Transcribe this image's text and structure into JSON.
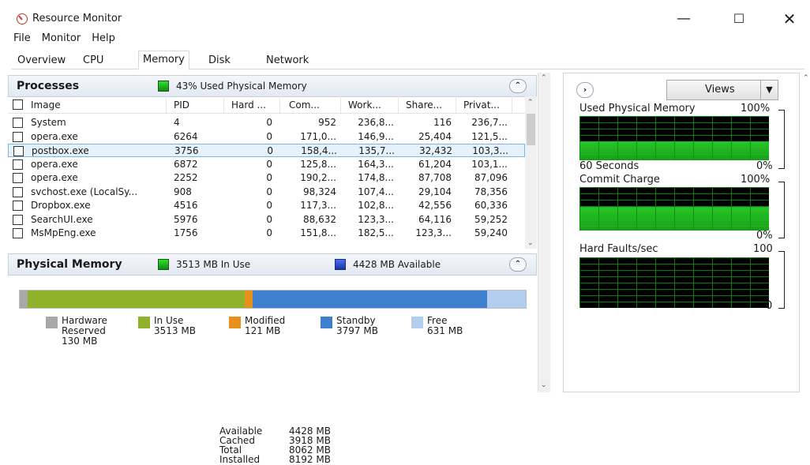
{
  "window": {
    "title": "Resource Monitor",
    "minimize": "—",
    "maximize": "☐",
    "close": "✕"
  },
  "menu": [
    "File",
    "Monitor",
    "Help"
  ],
  "tabs": [
    "Overview",
    "CPU",
    "Memory",
    "Disk",
    "Network"
  ],
  "active_tab": "Memory",
  "processes": {
    "title": "Processes",
    "summary": "43% Used Physical Memory",
    "columns": [
      "Image",
      "PID",
      "Hard ...",
      "Com...",
      "Work...",
      "Share...",
      "Privat..."
    ],
    "rows": [
      [
        "System",
        "4",
        "0",
        "952",
        "236,8...",
        "116",
        "236,7..."
      ],
      [
        "opera.exe",
        "6264",
        "0",
        "171,0...",
        "146,9...",
        "25,404",
        "121,5..."
      ],
      [
        "postbox.exe",
        "3756",
        "0",
        "158,4...",
        "135,7...",
        "32,432",
        "103,3..."
      ],
      [
        "opera.exe",
        "6872",
        "0",
        "125,8...",
        "164,3...",
        "61,204",
        "103,1..."
      ],
      [
        "opera.exe",
        "2252",
        "0",
        "190,2...",
        "174,8...",
        "87,708",
        "87,096"
      ],
      [
        "svchost.exe (LocalSy...",
        "908",
        "0",
        "98,324",
        "107,4...",
        "29,104",
        "78,356"
      ],
      [
        "Dropbox.exe",
        "4516",
        "0",
        "117,3...",
        "102,8...",
        "42,556",
        "60,336"
      ],
      [
        "SearchUI.exe",
        "5976",
        "0",
        "88,632",
        "123,3...",
        "64,116",
        "59,252"
      ],
      [
        "MsMpEng.exe",
        "1756",
        "0",
        "151,8...",
        "182,5...",
        "123,3...",
        "59,240"
      ]
    ],
    "selected_row": 2
  },
  "physical_memory": {
    "title": "Physical Memory",
    "in_use_label": "3513 MB In Use",
    "available_label": "4428 MB Available",
    "bar": [
      {
        "name": "Hardware Reserved",
        "mb": 130,
        "color": "#a8a8a8"
      },
      {
        "name": "In Use",
        "mb": 3513,
        "color": "#8fb22a"
      },
      {
        "name": "Modified",
        "mb": 121,
        "color": "#e8901c"
      },
      {
        "name": "Standby",
        "mb": 3797,
        "color": "#3f7fd0"
      },
      {
        "name": "Free",
        "mb": 631,
        "color": "#b2cdee"
      }
    ],
    "legend": [
      {
        "l1": "Hardware",
        "l2": "Reserved",
        "l3": "130 MB",
        "color": "#a8a8a8"
      },
      {
        "l1": "In Use",
        "l2": "3513 MB",
        "l3": "",
        "color": "#8fb22a"
      },
      {
        "l1": "Modified",
        "l2": "121 MB",
        "l3": "",
        "color": "#e8901c"
      },
      {
        "l1": "Standby",
        "l2": "3797 MB",
        "l3": "",
        "color": "#3f7fd0"
      },
      {
        "l1": "Free",
        "l2": "631 MB",
        "l3": "",
        "color": "#b2cdee"
      }
    ],
    "stats": [
      {
        "label": "Available",
        "value": "4428 MB"
      },
      {
        "label": "Cached",
        "value": "3918 MB"
      },
      {
        "label": "Total",
        "value": "8062 MB"
      },
      {
        "label": "Installed",
        "value": "8192 MB"
      }
    ]
  },
  "right": {
    "views_label": "Views",
    "graphs": [
      {
        "title": "Used Physical Memory",
        "max": "100%",
        "min": "0%",
        "time": "60 Seconds",
        "level": 0.43
      },
      {
        "title": "Commit Charge",
        "max": "100%",
        "min": "0%",
        "time": "",
        "level": 0.55
      },
      {
        "title": "Hard Faults/sec",
        "max": "100",
        "min": "0",
        "time": "",
        "level": 0.0
      }
    ]
  },
  "colors": {
    "graph_green": "#1cb81c",
    "selection": "#e5f1fb"
  }
}
